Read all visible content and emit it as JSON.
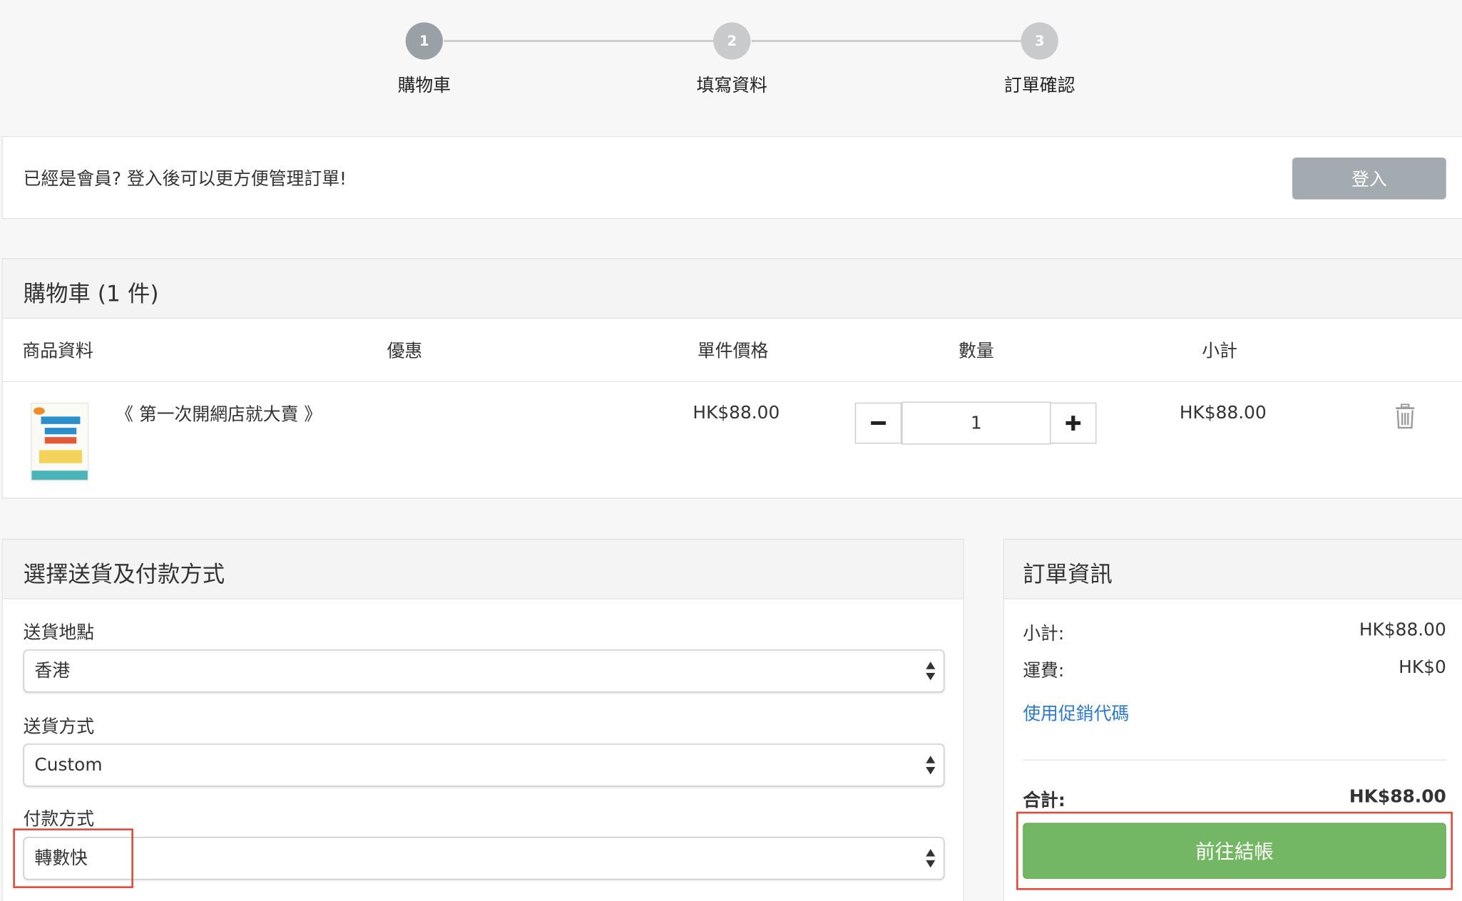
{
  "stepper": {
    "steps": [
      {
        "number": "1",
        "label": "購物車"
      },
      {
        "number": "2",
        "label": "填寫資料"
      },
      {
        "number": "3",
        "label": "訂單確認"
      }
    ]
  },
  "member": {
    "prompt": "已經是會員? 登入後可以更方便管理訂單!",
    "login_label": "登入"
  },
  "cart": {
    "title": "購物車 (1 件)",
    "columns": [
      "商品資料",
      "優惠",
      "單件價格",
      "數量",
      "小計"
    ],
    "items": [
      {
        "name": "《 第一次開網店就大賣 》",
        "unit_price": "HK$88.00",
        "quantity": "1",
        "subtotal": "HK$88.00",
        "cover_image": "book-cover",
        "delete_icon": "trash-icon"
      }
    ],
    "minus_icon": "minus-icon",
    "plus_icon": "plus-icon"
  },
  "shipping": {
    "title": "選擇送貨及付款方式",
    "location_label": "送貨地點",
    "location_value": "香港",
    "method_label": "送貨方式",
    "method_value": "Custom",
    "payment_label": "付款方式",
    "payment_value": "轉數快"
  },
  "summary": {
    "title": "訂單資訊",
    "subtotal_label": "小計:",
    "subtotal_value": "HK$88.00",
    "shipping_label": "運費:",
    "shipping_value": "HK$0",
    "promo_link": "使用促銷代碼",
    "total_label": "合計:",
    "total_value": "HK$88.00",
    "checkout_label": "前往結帳"
  },
  "colors": {
    "checkout": "#73b764",
    "login": "#a3aab0",
    "link": "#2f79c7",
    "highlight": "#e04a3b"
  }
}
